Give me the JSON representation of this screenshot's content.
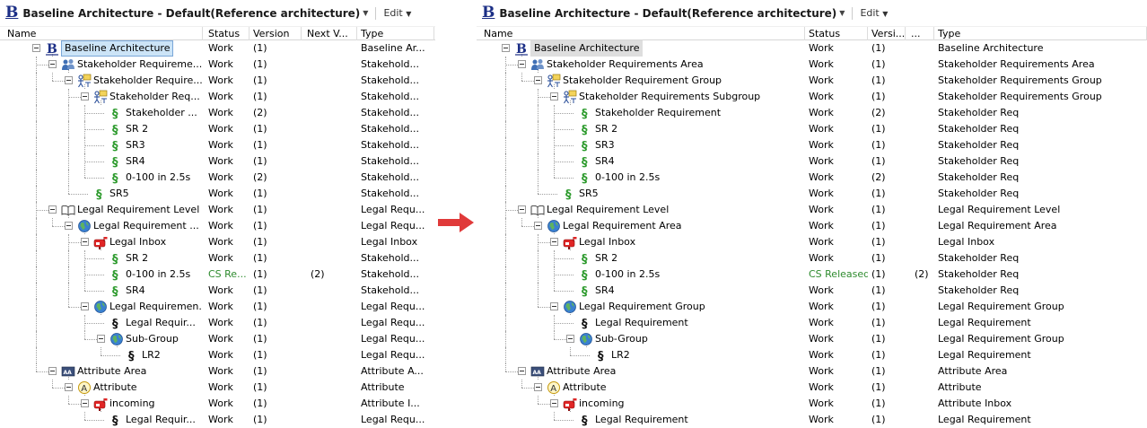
{
  "title": "Baseline Architecture - Default(Reference architecture)",
  "edit_menu": "Edit",
  "left": {
    "columns": [
      "Name",
      "Status",
      "Version",
      "Next V...",
      "Type"
    ],
    "rows": [
      {
        "name": "Baseline Architecture",
        "level": 0,
        "icon": "baseline-b-icon",
        "status": "Work",
        "version": "(1)",
        "next": "",
        "type": "Baseline Ar...",
        "expanded": true,
        "selected": true
      },
      {
        "name": "Stakeholder Requireme...",
        "level": 1,
        "icon": "people-icon",
        "status": "Work",
        "version": "(1)",
        "next": "",
        "type": "Stakehold...",
        "expanded": true
      },
      {
        "name": "Stakeholder Require...",
        "level": 2,
        "icon": "group-icon",
        "status": "Work",
        "version": "(1)",
        "next": "",
        "type": "Stakehold...",
        "expanded": true
      },
      {
        "name": "Stakeholder Req...",
        "level": 3,
        "icon": "group-icon",
        "status": "Work",
        "version": "(1)",
        "next": "",
        "type": "Stakehold...",
        "expanded": true
      },
      {
        "name": "Stakeholder ...",
        "level": 4,
        "icon": "section-green-icon",
        "status": "Work",
        "version": "(2)",
        "next": "",
        "type": "Stakehold..."
      },
      {
        "name": "SR 2",
        "level": 4,
        "icon": "section-green-icon",
        "status": "Work",
        "version": "(1)",
        "next": "",
        "type": "Stakehold..."
      },
      {
        "name": "SR3",
        "level": 4,
        "icon": "section-green-icon",
        "status": "Work",
        "version": "(1)",
        "next": "",
        "type": "Stakehold..."
      },
      {
        "name": "SR4",
        "level": 4,
        "icon": "section-green-icon",
        "status": "Work",
        "version": "(1)",
        "next": "",
        "type": "Stakehold..."
      },
      {
        "name": "0-100 in 2.5s",
        "level": 4,
        "icon": "section-green-icon",
        "status": "Work",
        "version": "(2)",
        "next": "",
        "type": "Stakehold..."
      },
      {
        "name": "SR5",
        "level": 3,
        "icon": "section-green-icon",
        "status": "Work",
        "version": "(1)",
        "next": "",
        "type": "Stakehold..."
      },
      {
        "name": "Legal Requirement Level",
        "level": 1,
        "icon": "book-icon",
        "status": "Work",
        "version": "(1)",
        "next": "",
        "type": "Legal Requ...",
        "expanded": true
      },
      {
        "name": "Legal Requirement ...",
        "level": 2,
        "icon": "globe-icon",
        "status": "Work",
        "version": "(1)",
        "next": "",
        "type": "Legal Requ...",
        "expanded": true
      },
      {
        "name": "Legal Inbox",
        "level": 3,
        "icon": "mailbox-icon",
        "status": "Work",
        "version": "(1)",
        "next": "",
        "type": "Legal Inbox",
        "expanded": true,
        "redText": true
      },
      {
        "name": "SR 2",
        "level": 4,
        "icon": "section-green-icon",
        "status": "Work",
        "version": "(1)",
        "next": "",
        "type": "Stakehold..."
      },
      {
        "name": "0-100 in 2.5s",
        "level": 4,
        "icon": "section-green-icon",
        "status": "CS Re...",
        "version": "(1)",
        "next": "(2)",
        "type": "Stakehold...",
        "green": true
      },
      {
        "name": "SR4",
        "level": 4,
        "icon": "section-green-icon",
        "status": "Work",
        "version": "(1)",
        "next": "",
        "type": "Stakehold..."
      },
      {
        "name": "Legal Requiremen...",
        "level": 3,
        "icon": "globe-icon",
        "status": "Work",
        "version": "(1)",
        "next": "",
        "type": "Legal Requ...",
        "expanded": true
      },
      {
        "name": "Legal Requir...",
        "level": 4,
        "icon": "section-black-icon",
        "status": "Work",
        "version": "(1)",
        "next": "",
        "type": "Legal Requ..."
      },
      {
        "name": "Sub-Group",
        "level": 4,
        "icon": "globe-icon",
        "status": "Work",
        "version": "(1)",
        "next": "",
        "type": "Legal Requ...",
        "expanded": true
      },
      {
        "name": "LR2",
        "level": 5,
        "icon": "section-black-icon",
        "status": "Work",
        "version": "(1)",
        "next": "",
        "type": "Legal Requ..."
      },
      {
        "name": "Attribute Area",
        "level": 1,
        "icon": "attr-area-icon",
        "status": "Work",
        "version": "(1)",
        "next": "",
        "type": "Attribute A...",
        "expanded": true
      },
      {
        "name": "Attribute",
        "level": 2,
        "icon": "attribute-a-icon",
        "status": "Work",
        "version": "(1)",
        "next": "",
        "type": "Attribute",
        "expanded": true
      },
      {
        "name": "incoming",
        "level": 3,
        "icon": "mailbox-icon",
        "status": "Work",
        "version": "(1)",
        "next": "",
        "type": "Attribute I...",
        "expanded": true
      },
      {
        "name": "Legal Requir...",
        "level": 4,
        "icon": "section-black-icon",
        "status": "Work",
        "version": "(1)",
        "next": "",
        "type": "Legal Requ..."
      }
    ]
  },
  "right": {
    "columns": [
      "Name",
      "Status",
      "Versi...",
      "...",
      "Type"
    ],
    "rows": [
      {
        "name": "Baseline Architecture",
        "level": 0,
        "icon": "baseline-b-icon",
        "status": "Work",
        "version": "(1)",
        "next": "",
        "type": "Baseline Architecture",
        "expanded": true,
        "selected": true
      },
      {
        "name": "Stakeholder Requirements Area",
        "level": 1,
        "icon": "people-icon",
        "status": "Work",
        "version": "(1)",
        "next": "",
        "type": "Stakeholder Requirements Area",
        "expanded": true
      },
      {
        "name": "Stakeholder Requirement Group",
        "level": 2,
        "icon": "group-icon",
        "status": "Work",
        "version": "(1)",
        "next": "",
        "type": "Stakeholder Requirements Group",
        "expanded": true
      },
      {
        "name": "Stakeholder Requirements Subgroup",
        "level": 3,
        "icon": "group-icon",
        "status": "Work",
        "version": "(1)",
        "next": "",
        "type": "Stakeholder Requirements Group",
        "expanded": true
      },
      {
        "name": "Stakeholder Requirement",
        "level": 4,
        "icon": "section-green-icon",
        "status": "Work",
        "version": "(2)",
        "next": "",
        "type": "Stakeholder Req"
      },
      {
        "name": "SR 2",
        "level": 4,
        "icon": "section-green-icon",
        "status": "Work",
        "version": "(1)",
        "next": "",
        "type": "Stakeholder Req"
      },
      {
        "name": "SR3",
        "level": 4,
        "icon": "section-green-icon",
        "status": "Work",
        "version": "(1)",
        "next": "",
        "type": "Stakeholder Req"
      },
      {
        "name": "SR4",
        "level": 4,
        "icon": "section-green-icon",
        "status": "Work",
        "version": "(1)",
        "next": "",
        "type": "Stakeholder Req"
      },
      {
        "name": "0-100 in 2.5s",
        "level": 4,
        "icon": "section-green-icon",
        "status": "Work",
        "version": "(2)",
        "next": "",
        "type": "Stakeholder Req"
      },
      {
        "name": "SR5",
        "level": 3,
        "icon": "section-green-icon",
        "status": "Work",
        "version": "(1)",
        "next": "",
        "type": "Stakeholder Req"
      },
      {
        "name": "Legal Requirement Level",
        "level": 1,
        "icon": "book-icon",
        "status": "Work",
        "version": "(1)",
        "next": "",
        "type": "Legal Requirement Level",
        "expanded": true
      },
      {
        "name": "Legal Requirement Area",
        "level": 2,
        "icon": "globe-icon",
        "status": "Work",
        "version": "(1)",
        "next": "",
        "type": "Legal Requirement Area",
        "expanded": true
      },
      {
        "name": "Legal Inbox",
        "level": 3,
        "icon": "mailbox-icon",
        "status": "Work",
        "version": "(1)",
        "next": "",
        "type": "Legal Inbox",
        "expanded": true
      },
      {
        "name": "SR 2",
        "level": 4,
        "icon": "section-green-icon",
        "status": "Work",
        "version": "(1)",
        "next": "",
        "type": "Stakeholder Req"
      },
      {
        "name": "0-100 in 2.5s",
        "level": 4,
        "icon": "section-green-icon",
        "status": "CS Released",
        "version": "(1)",
        "next": "(2)",
        "type": "Stakeholder Req",
        "green": true
      },
      {
        "name": "SR4",
        "level": 4,
        "icon": "section-green-icon",
        "status": "Work",
        "version": "(1)",
        "next": "",
        "type": "Stakeholder Req"
      },
      {
        "name": "Legal Requirement Group",
        "level": 3,
        "icon": "globe-icon",
        "status": "Work",
        "version": "(1)",
        "next": "",
        "type": "Legal Requirement Group",
        "expanded": true
      },
      {
        "name": "Legal Requirement",
        "level": 4,
        "icon": "section-black-icon",
        "status": "Work",
        "version": "(1)",
        "next": "",
        "type": "Legal Requirement"
      },
      {
        "name": "Sub-Group",
        "level": 4,
        "icon": "globe-icon",
        "status": "Work",
        "version": "(1)",
        "next": "",
        "type": "Legal Requirement Group",
        "expanded": true
      },
      {
        "name": "LR2",
        "level": 5,
        "icon": "section-black-icon",
        "status": "Work",
        "version": "(1)",
        "next": "",
        "type": "Legal Requirement"
      },
      {
        "name": "Attribute Area",
        "level": 1,
        "icon": "attr-area-icon",
        "status": "Work",
        "version": "(1)",
        "next": "",
        "type": "Attribute Area",
        "expanded": true
      },
      {
        "name": "Attribute",
        "level": 2,
        "icon": "attribute-a-icon",
        "status": "Work",
        "version": "(1)",
        "next": "",
        "type": "Attribute",
        "expanded": true
      },
      {
        "name": "incoming",
        "level": 3,
        "icon": "mailbox-icon",
        "status": "Work",
        "version": "(1)",
        "next": "",
        "type": "Attribute Inbox",
        "expanded": true
      },
      {
        "name": "Legal Requirement",
        "level": 4,
        "icon": "section-black-icon",
        "status": "Work",
        "version": "(1)",
        "next": "",
        "type": "Legal Requirement"
      }
    ]
  },
  "colors": {
    "status_released": "#2e8b2e",
    "section_green": "#2e9b2e",
    "arrow": "#e03a3a",
    "logo": "#1c2f86"
  }
}
